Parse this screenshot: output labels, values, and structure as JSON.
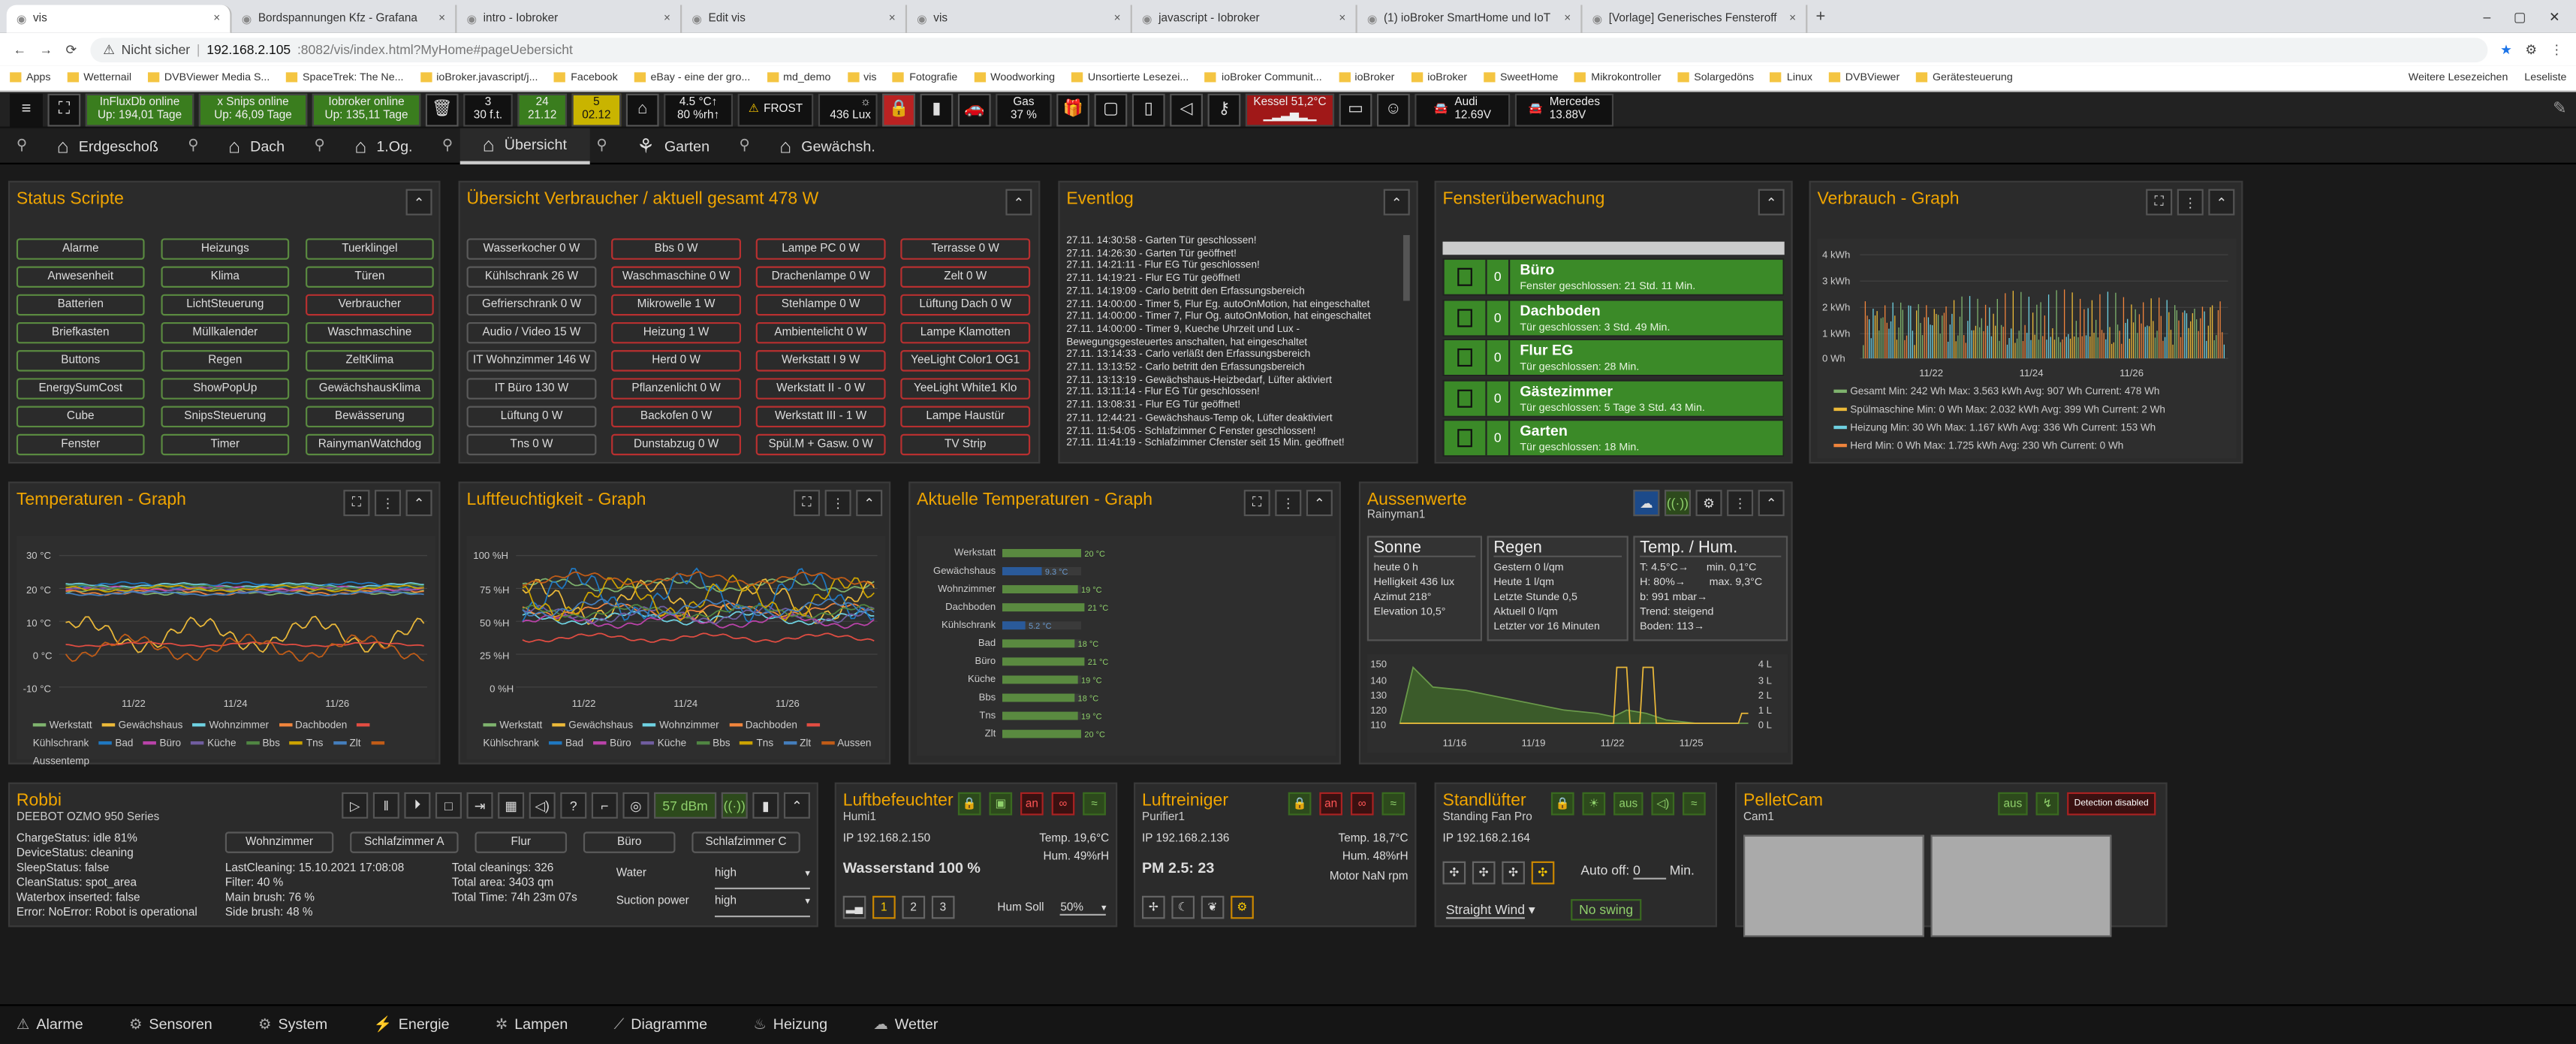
{
  "browser": {
    "tabs": [
      {
        "title": "vis",
        "active": true
      },
      {
        "title": "Bordspannungen Kfz - Grafana"
      },
      {
        "title": "intro - Iobroker"
      },
      {
        "title": "Edit vis"
      },
      {
        "title": "vis"
      },
      {
        "title": "javascript - Iobroker"
      },
      {
        "title": "(1) ioBroker SmartHome und IoT"
      },
      {
        "title": "[Vorlage] Generisches Fensteroff"
      }
    ],
    "not_secure": "Nicht sicher",
    "url_host": "192.168.2.105",
    "url_rest": ":8082/vis/index.html?MyHome#pageUebersicht",
    "bookmarks": [
      "Apps",
      "Wetternail",
      "DVBViewer Media S...",
      "SpaceTrek: The Ne...",
      "ioBroker.javascript/j...",
      "Facebook",
      "eBay - eine der gro...",
      "md_demo",
      "vis",
      "Fotografie",
      "Woodworking",
      "Unsortierte Lesezei...",
      "ioBroker Communit...",
      "ioBroker",
      "ioBroker",
      "SweetHome",
      "Mikrokontroller",
      "Solargedöns",
      "Linux",
      "DVBViewer",
      "Gerätesteuerung"
    ],
    "bookmarks_end": "Weitere Lesezeichen",
    "reading_list": "Leseliste"
  },
  "topbar": {
    "influx": "InFluxDb online",
    "influx_up": "Up: 194,01 Tage",
    "snips": "x Snips online",
    "snips_up": "Up: 46,09 Tage",
    "iob": "Iobroker online",
    "iob_up": "Up: 135,11 Tage",
    "c1a": "3",
    "c1b": "30 f.t.",
    "c2a": "24",
    "c2b": "21.12",
    "c3a": "5",
    "c3b": "02.12",
    "temp": "4.5 °C↑",
    "hum": "80 %rh↑",
    "frost": "FROST",
    "lux": "436 Lux",
    "gas": "Gas",
    "gas_pct": "37 %",
    "kessel": "Kessel 51,2°C",
    "audi": "Audi",
    "audi_v": "12.69V",
    "merc": "Mercedes",
    "merc_v": "13.88V"
  },
  "nav": {
    "items": [
      "Erdgeschoß",
      "Dach",
      "1.Og.",
      "Übersicht",
      "Garten",
      "Gewächsh."
    ]
  },
  "status": {
    "title": "Status Scripte",
    "buttons": [
      "Alarme",
      "Heizungs",
      "Tuerklingel",
      "Anwesenheit",
      "Klima",
      "Türen",
      "Batterien",
      "LichtSteuerung",
      "Verbraucher",
      "Briefkasten",
      "Müllkalender",
      "Waschmaschine",
      "Buttons",
      "Regen",
      "ZeltKlima",
      "EnergySumCost",
      "ShowPopUp",
      "GewächshausKlima",
      "Cube",
      "SnipsSteuerung",
      "Bewässerung",
      "Fenster",
      "Timer",
      "RainymanWatchdog"
    ]
  },
  "verbraucher": {
    "title": "Übersicht Verbraucher / aktuell gesamt 478 W",
    "buttons": [
      "Wasserkocher 0 W",
      "Bbs 0 W",
      "Lampe PC 0 W",
      "Terrasse 0 W",
      "Kühlschrank 26 W",
      "Waschmaschine 0 W",
      "Drachenlampe 0 W",
      "Zelt 0 W",
      "Gefrierschrank 0 W",
      "Mikrowelle 1 W",
      "Stehlampe 0 W",
      "Lüftung Dach 0 W",
      "Audio / Video 15 W",
      "Heizung 1 W",
      "Ambientelicht 0 W",
      "Lampe Klamotten",
      "IT Wohnzimmer 146 W",
      "Herd 0 W",
      "Werkstatt I 9 W",
      "YeeLight Color1 OG1",
      "IT Büro 130 W",
      "Pflanzenlicht 0 W",
      "Werkstatt II - 0 W",
      "YeeLight White1 Klo",
      "Lüftung 0 W",
      "Backofen 0 W",
      "Werkstatt III - 1 W",
      "Lampe Haustür",
      "Tns 0 W",
      "Dunstabzug 0 W",
      "Spül.M + Gasw. 0 W",
      "TV Strip"
    ]
  },
  "eventlog": {
    "title": "Eventlog",
    "lines": [
      "27.11. 14:30:58 - Garten Tür geschlossen!",
      "27.11. 14:26:30 - Garten Tür geöffnet!",
      "27.11. 14:21:11 - Flur EG Tür geschlossen!",
      "27.11. 14:19:21 - Flur EG Tür geöffnet!",
      "27.11. 14:19:09 - Carlo betritt den Erfassungsbereich",
      "27.11. 14:00:00 - Timer 5, Flur Eg. autoOnMotion, hat eingeschaltet",
      "27.11. 14:00:00 - Timer 7, Flur Og. autoOnMotion, hat eingeschaltet",
      "27.11. 14:00:00 - Timer 9, Kueche Uhrzeit und Lux -",
      "Bewegungsgesteuertes anschalten, hat eingeschaltet",
      "27.11. 13:14:33 - Carlo verläßt den Erfassungsbereich",
      "27.11. 13:13:52 - Carlo betritt den Erfassungsbereich",
      "27.11. 13:13:19 - Gewächshaus-Heizbedarf, Lüfter aktiviert",
      "27.11. 13:11:14 - Flur EG Tür geschlossen!",
      "27.11. 13:08:31 - Flur EG Tür geöffnet!",
      "27.11. 12:44:21 - Gewächshaus-Temp ok, Lüfter deaktiviert",
      "27.11. 11:54:05 - Schlafzimmer C Fenster geschlossen!",
      "27.11. 11:41:19 - Schlafzimmer Cfenster seit 15 Min. geöffnet!"
    ]
  },
  "fenster": {
    "title": "Fensterüberwachung",
    "rows": [
      {
        "count": "0",
        "name": "Büro",
        "status": "Fenster geschlossen: 21 Std. 11 Min."
      },
      {
        "count": "0",
        "name": "Dachboden",
        "status": "Tür geschlossen: 3 Std. 49 Min."
      },
      {
        "count": "0",
        "name": "Flur EG",
        "status": "Tür geschlossen: 28 Min."
      },
      {
        "count": "0",
        "name": "Gästezimmer",
        "status": "Tür geschlossen: 5 Tage 3 Std. 43 Min."
      },
      {
        "count": "0",
        "name": "Garten",
        "status": "Tür geschlossen: 18 Min."
      }
    ]
  },
  "verbrauch_graph": {
    "title": "Verbrauch - Graph",
    "legend": [
      "Gesamt  Min: 242 Wh  Max: 3.563 kWh  Avg: 907 Wh  Current: 478 Wh",
      "Spülmaschine  Min: 0 Wh  Max: 2.032 kWh  Avg: 399 Wh  Current: 2 Wh",
      "Heizung  Min: 30 Wh  Max: 1.167 kWh  Avg: 336 Wh  Current: 153 Wh",
      "Herd  Min: 0 Wh  Max: 1.725 kWh  Avg: 230 Wh  Current: 0 Wh"
    ],
    "colors": [
      "#7eb26d",
      "#eab839",
      "#6ed0e0",
      "#ef843c"
    ]
  },
  "temp_graph": {
    "title": "Temperaturen - Graph",
    "legend": [
      "Werkstatt",
      "Gewächshaus",
      "Wohnzimmer",
      "Dachboden",
      "Kühlschrank",
      "Bad",
      "Büro",
      "Küche",
      "Bbs",
      "Tns",
      "Zlt",
      "Aussentemp"
    ]
  },
  "hum_graph": {
    "title": "Luftfeuchtigkeit - Graph",
    "legend": [
      "Werkstatt",
      "Gewächshaus",
      "Wohnzimmer",
      "Dachboden",
      "Kühlschrank",
      "Bad",
      "Büro",
      "Küche",
      "Bbs",
      "Tns",
      "Zlt",
      "Aussen"
    ]
  },
  "akt_temp": {
    "title": "Aktuelle Temperaturen - Graph"
  },
  "aussen": {
    "title": "Aussenwerte",
    "sub": "Rainyman1",
    "sonne_title": "Sonne",
    "sonne": [
      "heute 0 h",
      "Helligkeit 436 lux",
      "Azimut 218°",
      "Elevation 10,5°"
    ],
    "regen_title": "Regen",
    "regen": [
      "Gestern 0 l/qm",
      "Heute 1 l/qm",
      "Letzte Stunde 0,5",
      "Aktuell 0 l/qm",
      "Letzter vor 16 Minuten"
    ],
    "th_title": "Temp. / Hum.",
    "th": [
      "T: 4.5°C→      min. 0,1°C",
      "H: 80%→        max. 9,3°C",
      "b: 991 mbar→",
      "Trend: steigend",
      "Boden: 113→"
    ]
  },
  "robbi": {
    "title": "Robbi",
    "sub": "DEEBOT OZMO 950 Series",
    "signal": "57 dBm",
    "rooms": [
      "Wohnzimmer",
      "Schlafzimmer A",
      "Flur",
      "Büro",
      "Schlafzimmer C"
    ],
    "status": [
      "ChargeStatus: idle 81%",
      "DeviceStatus: cleaning",
      "SleepStatus: false",
      "CleanStatus: spot_area",
      "Waterbox inserted: false",
      "Error: NoError: Robot is operational"
    ],
    "col2": [
      "LastCleaning: 15.10.2021 17:08:08",
      "Filter: 40 %",
      "Main brush: 76 %",
      "Side brush: 48 %"
    ],
    "col3": [
      "Total cleanings: 326",
      "Total area: 3403 qm",
      "Total Time: 74h 23m 07s"
    ],
    "water_label": "Water",
    "water": "high",
    "suction_label": "Suction power",
    "suction": "high"
  },
  "befeuchter": {
    "title": "Luftbefeuchter",
    "sub": "Humi1",
    "an": "an",
    "ip": "IP 192.168.2.150",
    "temp": "Temp. 19,6°C",
    "hum": "Hum. 49%rH",
    "main": "Wasserstand 100 %",
    "soll_label": "Hum Soll",
    "soll": "50%"
  },
  "reiniger": {
    "title": "Luftreiniger",
    "sub": "Purifier1",
    "an": "an",
    "ip": "IP 192.168.2.136",
    "temp": "Temp. 18,7°C",
    "hum": "Hum. 48%rH",
    "main": "PM 2.5: 23",
    "motor": "Motor NaN rpm"
  },
  "standluefter": {
    "title": "Standlüfter",
    "sub": "Standing Fan Pro",
    "aus": "aus",
    "ip": "IP 192.168.2.164",
    "auto": "Auto off:",
    "auto_val": "0",
    "min": "Min.",
    "mode": "Straight Wind",
    "swing": "No swing"
  },
  "pellet": {
    "title": "PelletCam",
    "sub": "Cam1",
    "aus": "aus",
    "det": "Detection disabled"
  },
  "footer": [
    "Alarme",
    "Sensoren",
    "System",
    "Energie",
    "Lampen",
    "Diagramme",
    "Heizung",
    "Wetter"
  ]
}
